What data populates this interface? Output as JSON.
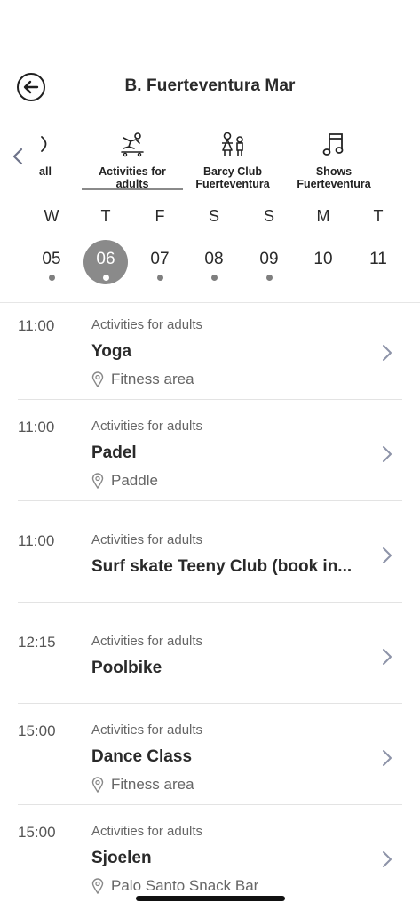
{
  "header": {
    "title": "B. Fuerteventura Mar"
  },
  "tabs": [
    {
      "label": "all",
      "icon": "moon-icon",
      "active": false
    },
    {
      "label": "Activities for\nadults",
      "icon": "skater-icon",
      "active": true
    },
    {
      "label": "Barcy Club\nFuerteventura",
      "icon": "children-icon",
      "active": false
    },
    {
      "label": "Shows\nFuerteventura",
      "icon": "music-note-icon",
      "active": false
    }
  ],
  "days": [
    {
      "name": "W",
      "num": "05",
      "dot": true,
      "selected": false
    },
    {
      "name": "T",
      "num": "06",
      "dot": true,
      "selected": true
    },
    {
      "name": "F",
      "num": "07",
      "dot": true,
      "selected": false
    },
    {
      "name": "S",
      "num": "08",
      "dot": true,
      "selected": false
    },
    {
      "name": "S",
      "num": "09",
      "dot": true,
      "selected": false
    },
    {
      "name": "M",
      "num": "10",
      "dot": false,
      "selected": false
    },
    {
      "name": "T",
      "num": "11",
      "dot": false,
      "selected": false
    }
  ],
  "events": [
    {
      "time": "11:00",
      "category": "Activities for adults",
      "name": "Yoga",
      "location": "Fitness area"
    },
    {
      "time": "11:00",
      "category": "Activities for adults",
      "name": "Padel",
      "location": "Paddle"
    },
    {
      "time": "11:00",
      "category": "Activities for adults",
      "name": "Surf skate Teeny Club (book in...",
      "location": ""
    },
    {
      "time": "12:15",
      "category": "Activities for adults",
      "name": "Poolbike",
      "location": ""
    },
    {
      "time": "15:00",
      "category": "Activities for adults",
      "name": "Dance Class",
      "location": "Fitness area"
    },
    {
      "time": "15:00",
      "category": "Activities for adults",
      "name": "Sjoelen",
      "location": "Palo Santo Snack Bar"
    }
  ],
  "colors": {
    "selected_day": "#8a8a8a",
    "dot": "#7f7f7f",
    "chevron": "#8d93a8"
  }
}
